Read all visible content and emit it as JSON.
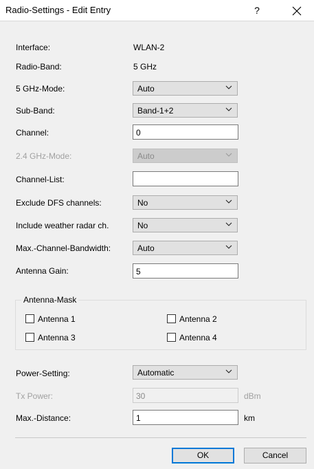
{
  "window": {
    "title": "Radio-Settings - Edit Entry",
    "help_label": "?",
    "close_label": "✕"
  },
  "fields": {
    "interface": {
      "label": "Interface:",
      "value": "WLAN-2"
    },
    "radio_band": {
      "label": "Radio-Band:",
      "value": "5 GHz"
    },
    "mode_5ghz": {
      "label": "5 GHz-Mode:",
      "value": "Auto"
    },
    "sub_band": {
      "label": "Sub-Band:",
      "value": "Band-1+2"
    },
    "channel": {
      "label": "Channel:",
      "value": "0"
    },
    "mode_24ghz": {
      "label": "2.4 GHz-Mode:",
      "value": "Auto"
    },
    "channel_list": {
      "label": "Channel-List:",
      "value": ""
    },
    "exclude_dfs": {
      "label": "Exclude DFS channels:",
      "value": "No"
    },
    "weather_radar": {
      "label": "Include weather radar ch.",
      "value": "No"
    },
    "max_bandwidth": {
      "label": "Max.-Channel-Bandwidth:",
      "value": "Auto"
    },
    "antenna_gain": {
      "label": "Antenna Gain:",
      "value": "5"
    },
    "power_setting": {
      "label": "Power-Setting:",
      "value": "Automatic"
    },
    "tx_power": {
      "label": "Tx Power:",
      "value": "30",
      "unit": "dBm"
    },
    "max_distance": {
      "label": "Max.-Distance:",
      "value": "1",
      "unit": "km"
    }
  },
  "antenna_mask": {
    "title": "Antenna-Mask",
    "items": [
      {
        "label": "Antenna 1",
        "checked": false
      },
      {
        "label": "Antenna 2",
        "checked": false
      },
      {
        "label": "Antenna 3",
        "checked": false
      },
      {
        "label": "Antenna 4",
        "checked": false
      }
    ]
  },
  "buttons": {
    "ok": "OK",
    "cancel": "Cancel"
  },
  "colors": {
    "dialog_bg": "#f0f0f0",
    "default_button_border": "#0078d7",
    "disabled_text": "#a0a0a0"
  }
}
